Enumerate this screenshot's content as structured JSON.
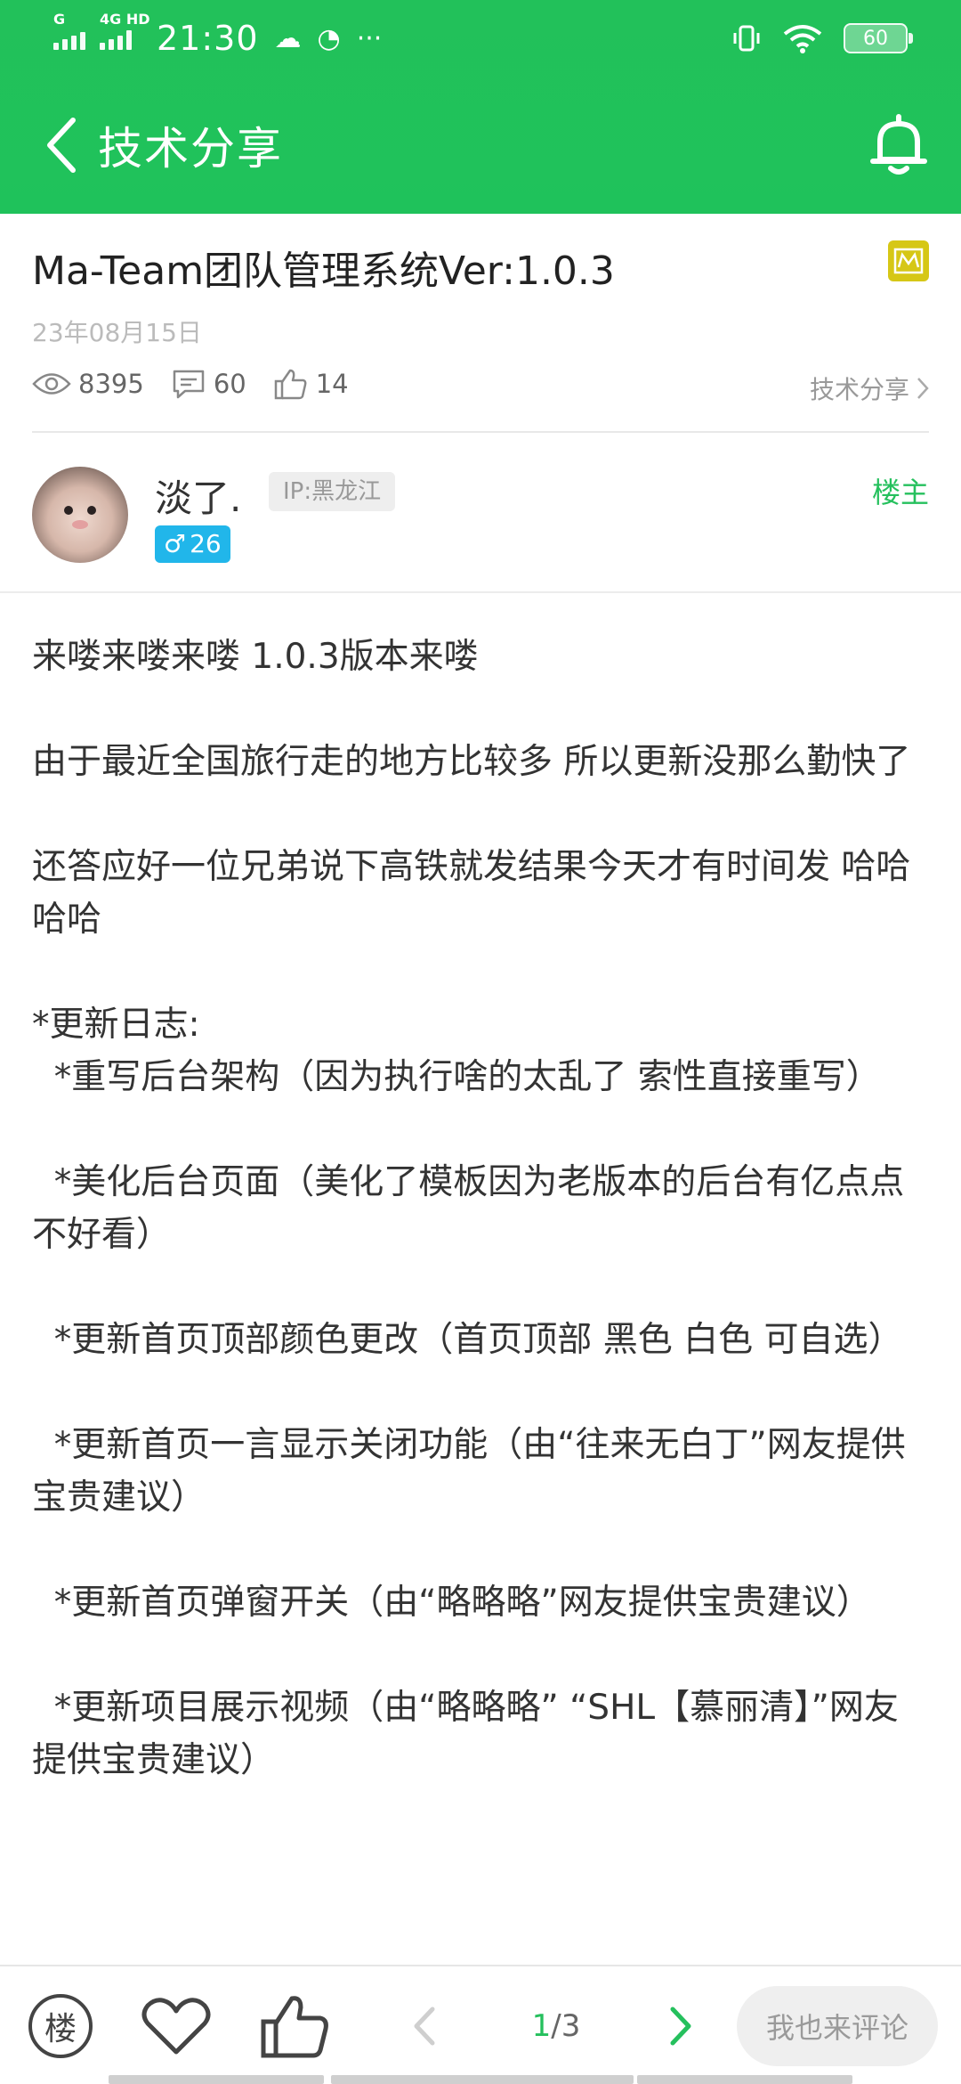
{
  "status_bar": {
    "network_tag_1": "G",
    "network_tag_2": "4G HD",
    "time": "21:30",
    "battery": "60"
  },
  "nav": {
    "title": "技术分享"
  },
  "post": {
    "title": "Ma-Team团队管理系统Ver:1.0.3",
    "date": "23年08月15日",
    "views": "8395",
    "comments": "60",
    "likes": "14",
    "category": "技术分享"
  },
  "author": {
    "name": "淡了.",
    "ip": "IP:黑龙江",
    "gender_symbol": "♂",
    "level": "26",
    "role": "楼主"
  },
  "content": {
    "p1": "来喽来喽来喽 1.0.3版本来喽",
    "p2": "由于最近全国旅行走的地方比较多 所以更新没那么勤快了",
    "p3": "还答应好一位兄弟说下高铁就发结果今天才有时间发 哈哈哈哈",
    "p4": "*更新日志:",
    "p5": "*重写后台架构（因为执行啥的太乱了 索性直接重写）",
    "p6": "*美化后台页面（美化了模板因为老版本的后台有亿点点不好看）",
    "p7": "*更新首页顶部颜色更改（首页顶部 黑色 白色 可自选）",
    "p8": "*更新首页一言显示关闭功能（由“往来无白丁”网友提供宝贵建议）",
    "p9": "*更新首页弹窗开关（由“略略略”网友提供宝贵建议）",
    "p10": "*更新项目展示视频（由“略略略” “SHL【慕丽清】”网友提供宝贵建议）"
  },
  "bottom_bar": {
    "floor_label": "楼",
    "page_current": "1",
    "page_total": "/3",
    "comment_placeholder": "我也来评论"
  },
  "colors": {
    "brand_green": "#22c15a",
    "vip_badge": "#d6c716",
    "gender_tag": "#21b6ea"
  }
}
